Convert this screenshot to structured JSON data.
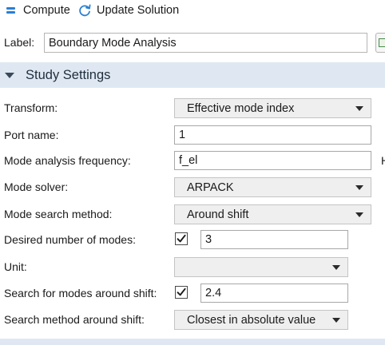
{
  "toolbar": {
    "compute_label": "Compute",
    "update_label": "Update Solution"
  },
  "label_row": {
    "label": "Label:",
    "value": "Boundary Mode Analysis"
  },
  "section": {
    "title": "Study Settings"
  },
  "settings": {
    "transform": {
      "label": "Transform:",
      "value": "Effective mode index"
    },
    "port_name": {
      "label": "Port name:",
      "value": "1"
    },
    "frequency": {
      "label": "Mode analysis frequency:",
      "value": "f_el",
      "unit": "H"
    },
    "solver": {
      "label": "Mode solver:",
      "value": "ARPACK"
    },
    "search_method": {
      "label": "Mode search method:",
      "value": "Around shift"
    },
    "num_modes": {
      "label": "Desired number of modes:",
      "checked": true,
      "value": "3"
    },
    "unit": {
      "label": "Unit:",
      "value": ""
    },
    "search_shift": {
      "label": "Search for modes around shift:",
      "checked": true,
      "value": "2.4"
    },
    "shift_method": {
      "label": "Search method around shift:",
      "value": "Closest in absolute value"
    }
  },
  "colors": {
    "accent": "#2a7fd4",
    "section_bg": "#dfe8f2",
    "dropdown_bg": "#efefef"
  },
  "icons": {
    "compute": "compute-icon",
    "update": "refresh-icon",
    "collapse": "triangle-down-icon",
    "label_action": "label-action-icon"
  }
}
